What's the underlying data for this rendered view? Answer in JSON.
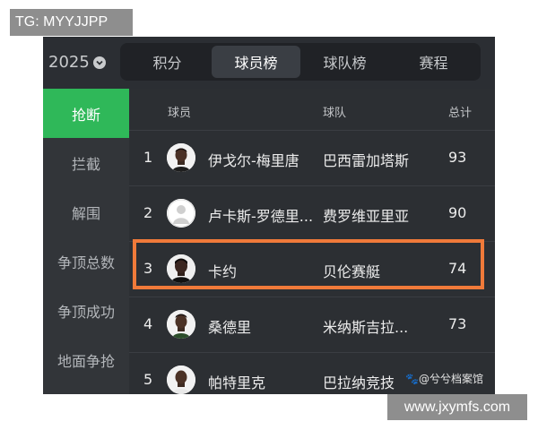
{
  "overlay": {
    "top_left": "TG: MYYJJPP",
    "bottom_right": "www.jxymfs.com"
  },
  "season": {
    "year": "2025"
  },
  "tabs": [
    {
      "label": "积分",
      "active": false
    },
    {
      "label": "球员榜",
      "active": true
    },
    {
      "label": "球队榜",
      "active": false
    },
    {
      "label": "赛程",
      "active": false
    }
  ],
  "sidebar": {
    "items": [
      {
        "label": "抢断",
        "active": true
      },
      {
        "label": "拦截",
        "active": false
      },
      {
        "label": "解围",
        "active": false
      },
      {
        "label": "争顶总数",
        "active": false
      },
      {
        "label": "争顶成功",
        "active": false
      },
      {
        "label": "地面争抢",
        "active": false
      }
    ]
  },
  "table": {
    "headers": {
      "player": "球员",
      "team": "球队",
      "total": "总计"
    },
    "rows": [
      {
        "rank": "1",
        "name": "伊戈尔-梅里唐",
        "team": "巴西雷加塔斯",
        "total": "93"
      },
      {
        "rank": "2",
        "name": "卢卡斯-罗德里...",
        "team": "费罗维亚里亚",
        "total": "90"
      },
      {
        "rank": "3",
        "name": "卡约",
        "team": "贝伦赛艇",
        "total": "74"
      },
      {
        "rank": "4",
        "name": "桑德里",
        "team": "米纳斯吉拉...",
        "total": "73"
      },
      {
        "rank": "5",
        "name": "帕特里克",
        "team": "巴拉纳竞技",
        "total": ""
      }
    ]
  },
  "watermark": "🐾@兮兮档案馆",
  "colors": {
    "accent": "#2fb859",
    "highlight": "#f07a3a"
  }
}
